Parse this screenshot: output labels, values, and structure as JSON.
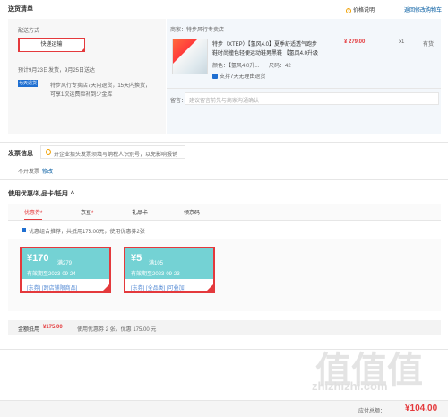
{
  "header": {
    "title": "送货清单",
    "price_note": "价格说明",
    "return_link": "返回修改购物车"
  },
  "delivery": {
    "section_label": "配送方式",
    "method_button": "快递运输",
    "schedule": "预计9月23日发货，9月25日送达",
    "service_icon": "七天退货",
    "service_text_1": "特步风行专卖店7天内退货，15天内换货，",
    "service_text_2": "可享1次运费险补到少金库"
  },
  "shop": {
    "label": "商家：特步风行专卖店",
    "product_title_1": "特步（XTEP）【氢风4.0】夏季舒适透气跑步",
    "product_title_2": "鞋时尚撞色轻便运动鞋男黑鞋 【氢风4.0升级",
    "product_color": "颜色：【氢风4.0升...",
    "product_size": "尺码：42",
    "price": "¥ 279.00",
    "qty": "x1",
    "stock": "有货",
    "return_tag": "支持7天无理由退货",
    "remark_label": "留言：",
    "remark_placeholder": "建议留言前先与商家沟通确认"
  },
  "invoice": {
    "title": "发票信息",
    "tip": "开企业抬头发票须填写纳税人识别号，以免影响报销",
    "type": "不开发票",
    "edit": "修改"
  },
  "coupons": {
    "title": "使用优惠/礼品卡/抵用",
    "tabs": [
      {
        "label": "优惠券",
        "dot": true
      },
      {
        "label": "京豆",
        "dot": true
      },
      {
        "label": "礼品卡",
        "dot": false
      },
      {
        "label": "领京码",
        "dot": false
      }
    ],
    "recommend_text": "优惠组合推荐，共抵用175.00元，使用优惠券2张",
    "list": [
      {
        "amount": "¥170",
        "cond": "满279",
        "valid": "有效期至2023-09-24",
        "tags": "[东券]  [跨店铺限商品]"
      },
      {
        "amount": "¥5",
        "cond": "满105",
        "valid": "有效期至2023-09-23",
        "tags": "[东券]  [全品类]  [可叠加]"
      }
    ]
  },
  "summary": {
    "label": "金额抵用",
    "amount": "¥175.00",
    "detail": "使用优惠券 2 张，优惠 175.00 元"
  },
  "footer": {
    "total_label": "应付总额：",
    "total": "¥104.00",
    "watermark_site": "zhizhizhi.com",
    "watermark_logo": "值值值"
  }
}
